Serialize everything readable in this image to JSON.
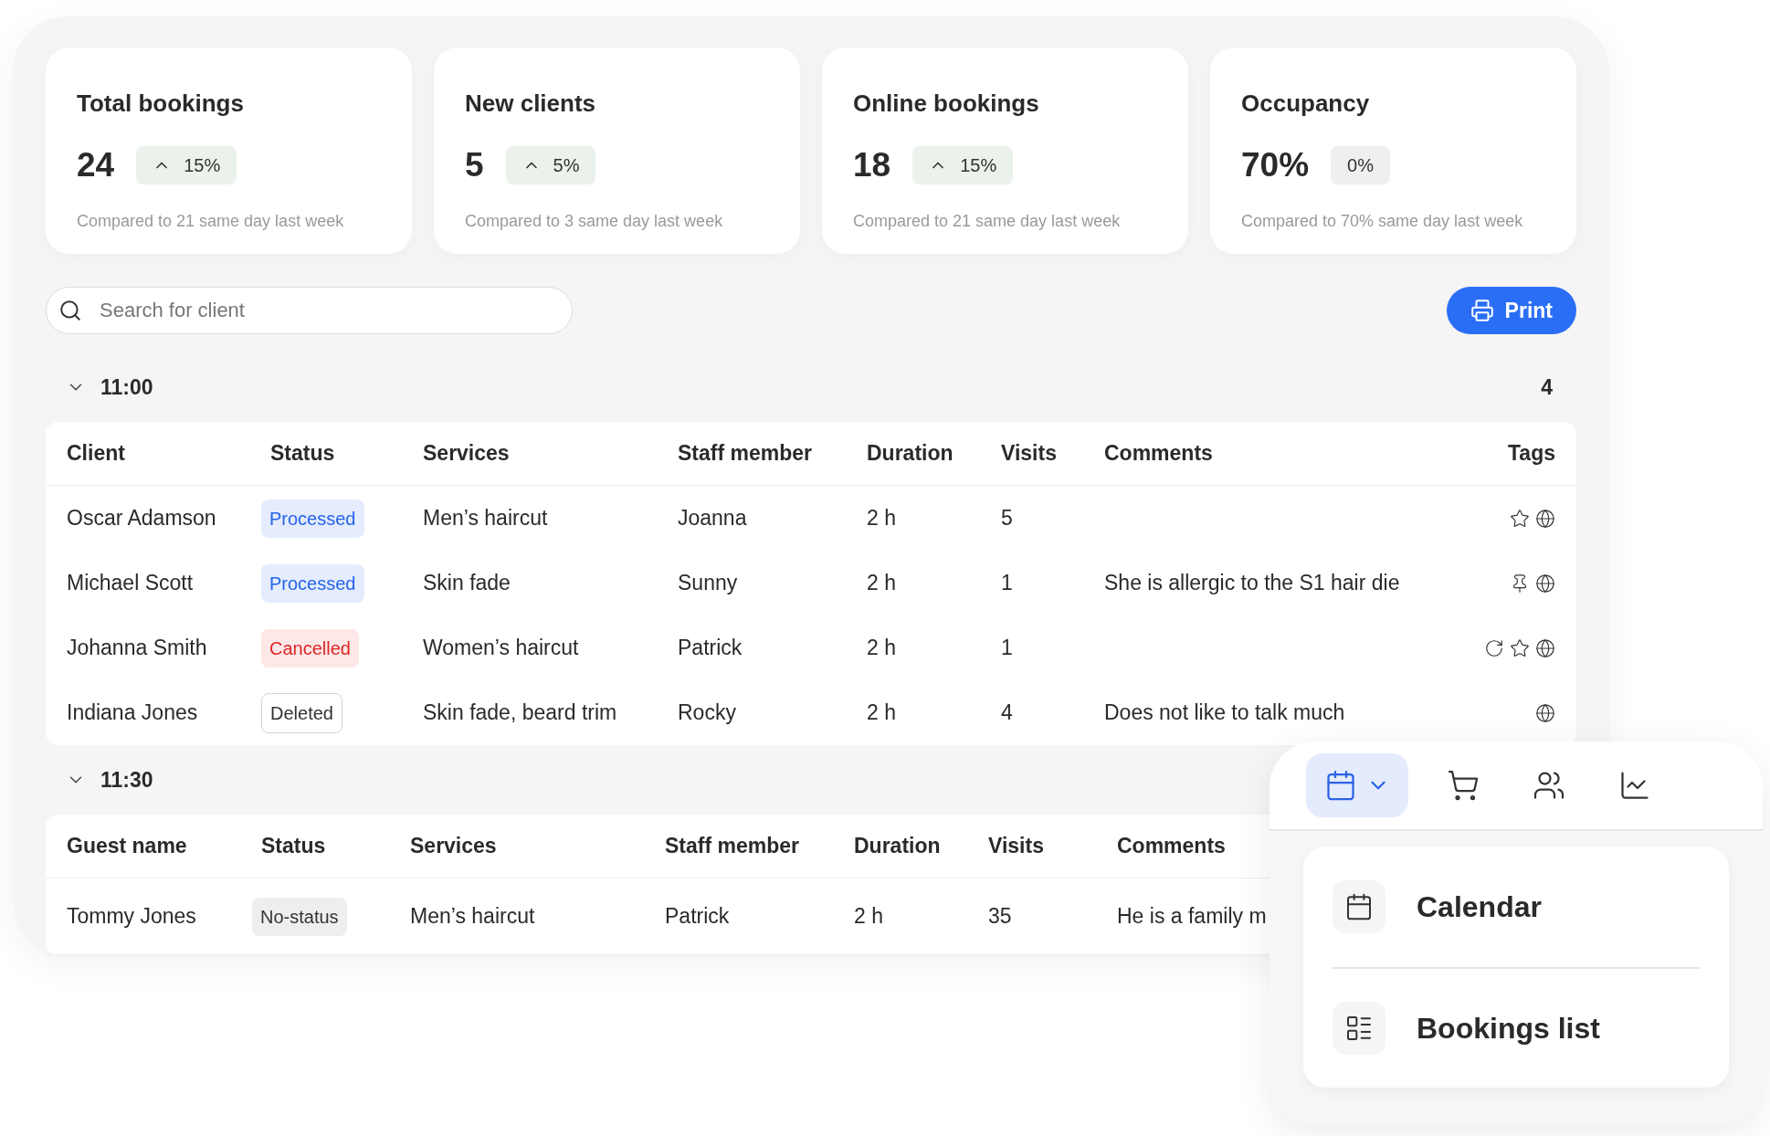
{
  "stats": [
    {
      "title": "Total bookings",
      "value": "24",
      "rising": true,
      "change": "15%",
      "note": "Compared to 21 same day last week"
    },
    {
      "title": "New clients",
      "value": "5",
      "rising": true,
      "change": "5%",
      "note": "Compared to 3 same day last week"
    },
    {
      "title": "Online bookings",
      "value": "18",
      "rising": true,
      "change": "15%",
      "note": "Compared to 21 same day last week"
    },
    {
      "title": "Occupancy",
      "value": "70%",
      "rising": false,
      "change": "0%",
      "note": "Compared to 70% same day last week"
    }
  ],
  "search": {
    "placeholder": "Search for client"
  },
  "print_button": "Print",
  "groups": [
    {
      "time": "11:00",
      "expanded": true,
      "count": "4",
      "columns": [
        "Client",
        "Status",
        "Services",
        "Staff member",
        "Duration",
        "Visits",
        "Comments",
        "Tags"
      ],
      "rows": [
        {
          "client": "Oscar Adamson",
          "status": {
            "text": "Processed",
            "kind": "processed"
          },
          "services": "Men’s haircut",
          "staff": "Joanna",
          "duration": "2 h",
          "visits": "5",
          "tags": [
            {
              "kind": "star"
            },
            {
              "kind": "globe"
            }
          ]
        },
        {
          "client": "Michael Scott",
          "status": {
            "text": "Processed",
            "kind": "processed"
          },
          "services": "Skin fade",
          "staff": "Sunny",
          "duration": "2 h",
          "visits": "1",
          "comment": "She is allergic to the S1 hair die",
          "tags": [
            {
              "kind": "pin"
            },
            {
              "kind": "globe"
            }
          ]
        },
        {
          "client": "Johanna Smith",
          "status": {
            "text": "Cancelled",
            "kind": "cancelled"
          },
          "services": "Women’s haircut",
          "staff": "Patrick",
          "duration": "2 h",
          "visits": "1",
          "tags": [
            {
              "kind": "repeat"
            },
            {
              "kind": "star"
            },
            {
              "kind": "globe"
            }
          ]
        },
        {
          "client": "Indiana Jones",
          "status": {
            "text": "Deleted",
            "kind": "deleted"
          },
          "services": "Skin fade, beard trim",
          "staff": "Rocky",
          "duration": "2 h",
          "visits": "4",
          "comment": "Does not like to talk much",
          "tags": [
            {
              "kind": "globe"
            }
          ]
        }
      ]
    },
    {
      "time": "11:30",
      "expanded": true,
      "columns": [
        "Guest name",
        "Status",
        "Services",
        "Staff member",
        "Duration",
        "Visits",
        "Comments"
      ],
      "rows": [
        {
          "client": "Tommy Jones",
          "status": {
            "text": "No-status",
            "kind": "none"
          },
          "services": "Men’s haircut",
          "staff": "Patrick",
          "duration": "2 h",
          "visits": "35",
          "comment": "He is a family m"
        }
      ]
    }
  ],
  "nav": {
    "toolbar": [
      {
        "kind": "calendar",
        "selected": true
      },
      {
        "kind": "cart",
        "selected": false
      },
      {
        "kind": "people",
        "selected": false
      },
      {
        "kind": "chart",
        "selected": false
      }
    ],
    "menu": [
      {
        "kind": "calendar",
        "label": "Calendar"
      },
      {
        "kind": "list",
        "label": "Bookings list"
      }
    ]
  }
}
